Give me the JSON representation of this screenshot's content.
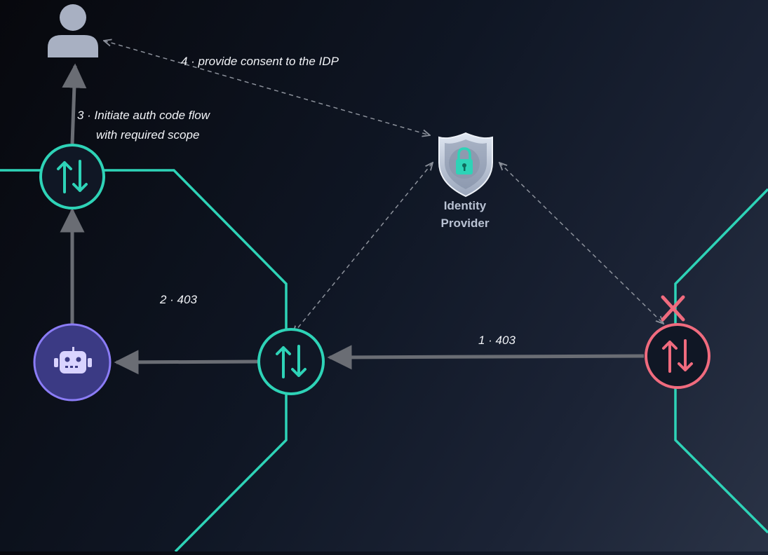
{
  "diagram": {
    "steps": {
      "step1": "1 · 403",
      "step2": "2 · 403",
      "step3_line1": "3 · Initiate auth code flow",
      "step3_line2": "with required scope",
      "step4": "4 · provide consent to the IDP"
    },
    "identity_provider": {
      "line1": "Identity",
      "line2": "Provider"
    },
    "nodes": {
      "user": "user-icon",
      "agent": "robot-icon",
      "gateway_top": "up-down-arrows-icon",
      "gateway_mid": "up-down-arrows-icon",
      "gateway_blocked": "up-down-arrows-icon",
      "blocked_marker": "x-mark-icon",
      "idp": "shield-lock-icon"
    },
    "colors": {
      "teal": "#2ed3b7",
      "blocked": "#f06b7e",
      "agent_fill": "#3b3a84",
      "agent_ring": "#8b7cf6",
      "arrow": "#6a6d74",
      "dashed": "#8c919b",
      "user": "#a8b0c2"
    }
  }
}
